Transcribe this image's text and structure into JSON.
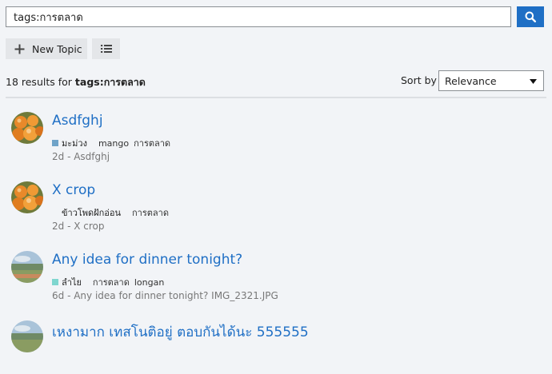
{
  "search": {
    "value": "tags:การตลาด"
  },
  "toolbar": {
    "new_topic_label": "New Topic"
  },
  "results": {
    "count_prefix": "18 results for",
    "query": "tags:การตลาด",
    "sort_label": "Sort by",
    "sort_value": "Relevance"
  },
  "colors": {
    "accent": "#1f6fc5",
    "cat_mango": "#6fa3c8",
    "cat_longan": "#7fd6cf"
  },
  "topics": [
    {
      "title": "Asdfghj",
      "category": "มะม่วง",
      "category_color": "#6fa3c8",
      "tags": [
        "mango",
        "การตลาด"
      ],
      "excerpt": "2d - Asdfghj",
      "avatar": "oranges"
    },
    {
      "title": "X crop",
      "category": "ข้าวโพดฝักอ่อน",
      "category_color": "",
      "tags": [
        "การตลาด"
      ],
      "excerpt": "2d - X crop",
      "avatar": "oranges"
    },
    {
      "title": "Any idea for dinner tonight?",
      "category": "ลำไย",
      "category_color": "#7fd6cf",
      "tags": [
        "การตลาด",
        "longan"
      ],
      "excerpt": "6d - Any idea for dinner tonight? IMG_2321.JPG",
      "avatar": "landscape"
    },
    {
      "title": "เหงามาก เทสโนติอยู่ ตอบกันได้นะ 555555",
      "category": "",
      "category_color": "",
      "tags": [],
      "excerpt": "",
      "avatar": "landscape"
    }
  ]
}
